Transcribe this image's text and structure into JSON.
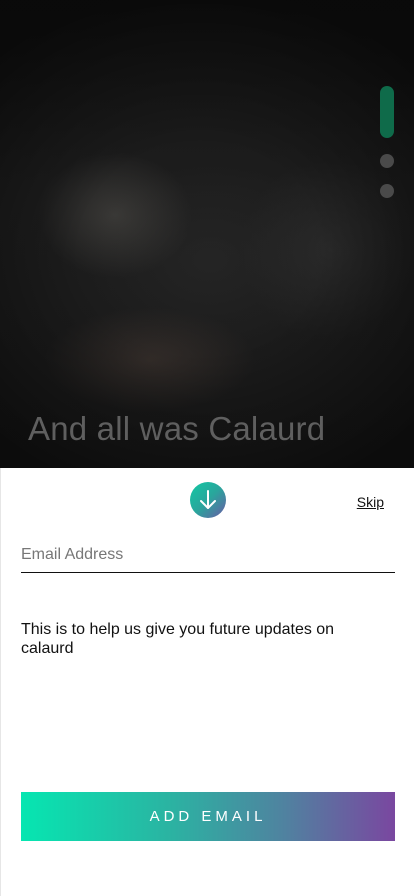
{
  "hero": {
    "title": "And all was Calaurd",
    "pager": {
      "total": 3,
      "active": 1
    }
  },
  "sheet": {
    "collapse_icon": "arrow-down-icon",
    "skip_label": "Skip",
    "email": {
      "placeholder": "Email Address",
      "value": ""
    },
    "helper_text": "This is to help us give you future updates on calaurd",
    "add_button_label": "ADD EMAIL"
  },
  "colors": {
    "pager_active": "#0f6b4a",
    "gradient_start": "#06e6b1",
    "gradient_end": "#7a47a0"
  }
}
